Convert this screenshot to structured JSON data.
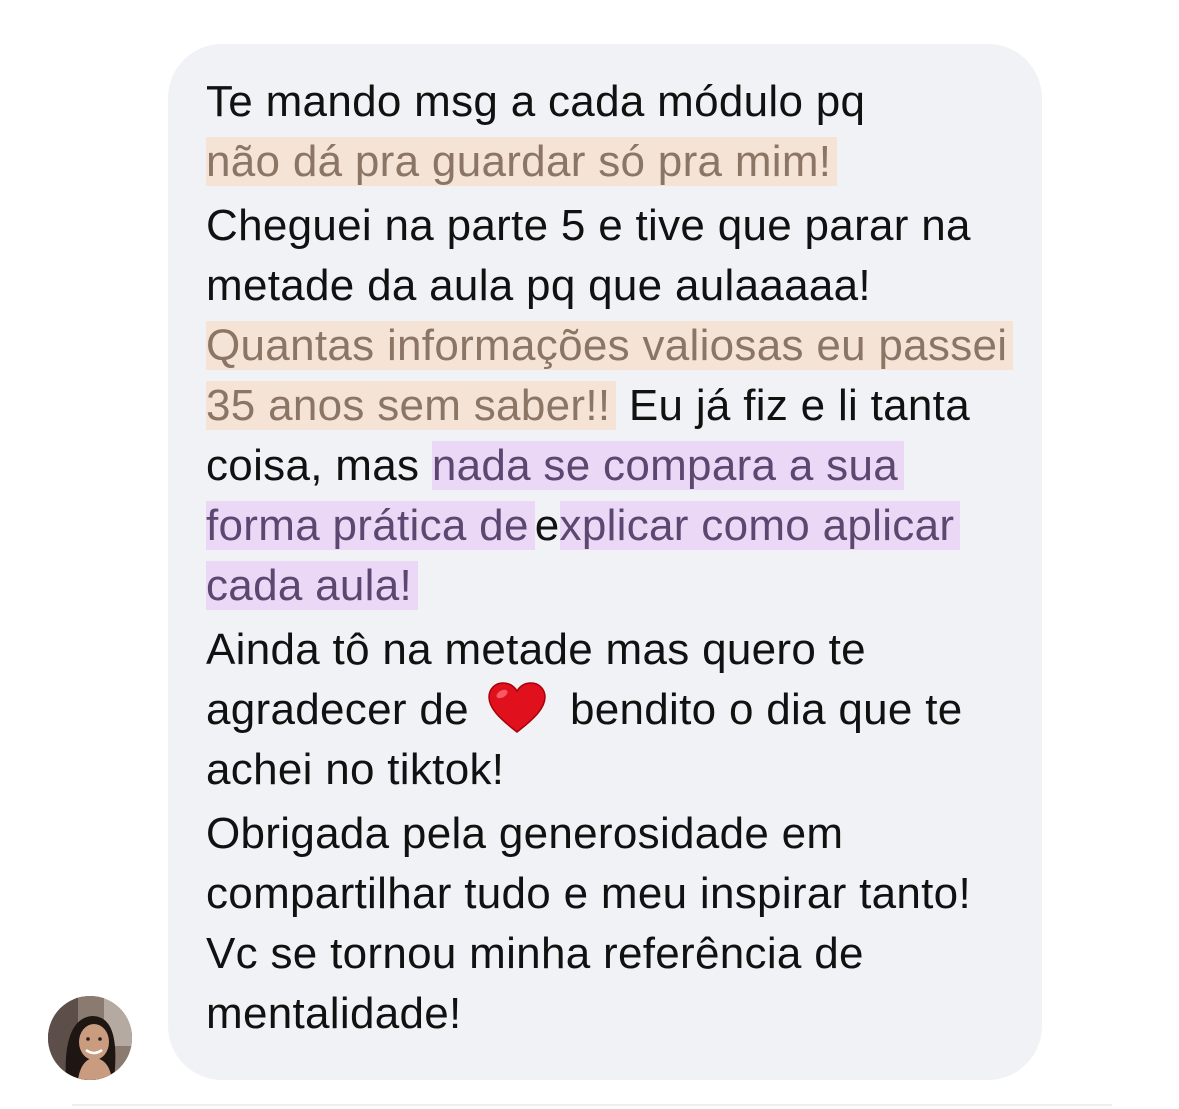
{
  "message": {
    "p1_line1": "Te mando msg a cada módulo pq",
    "p1_highlight": "não dá pra guardar só pra mim!",
    "p2_text1": "Cheguei na parte 5 e tive que parar na metade da aula pq que aulaaaaa!",
    "p2_highlight1": "Quantas informações valiosas eu passei 35 anos sem saber!!",
    "p2_text2": "Eu já fiz e li tanta coisa, mas",
    "p2_highlight2": "nada se compara a sua forma prática de",
    "p2_text3": "e",
    "p2_highlight3": "xplicar como aplicar cada aula!",
    "p3_text1": "Ainda tô na metade mas quero te agradecer de",
    "p3_text2": "bendito o dia que te achei no tiktok!",
    "p4_text": "Obrigada pela generosidade em compartilhar tudo e meu inspirar tanto! Vc se tornou minha referência de mentalidade!"
  },
  "icons": {
    "heart": "heart-emoji",
    "avatar": "sender-avatar"
  },
  "colors": {
    "bubble_bg": "#f1f2f5",
    "highlight_peach": "#f5e3d6",
    "highlight_lilac": "#ead8f6",
    "heart": "#e0101c"
  }
}
